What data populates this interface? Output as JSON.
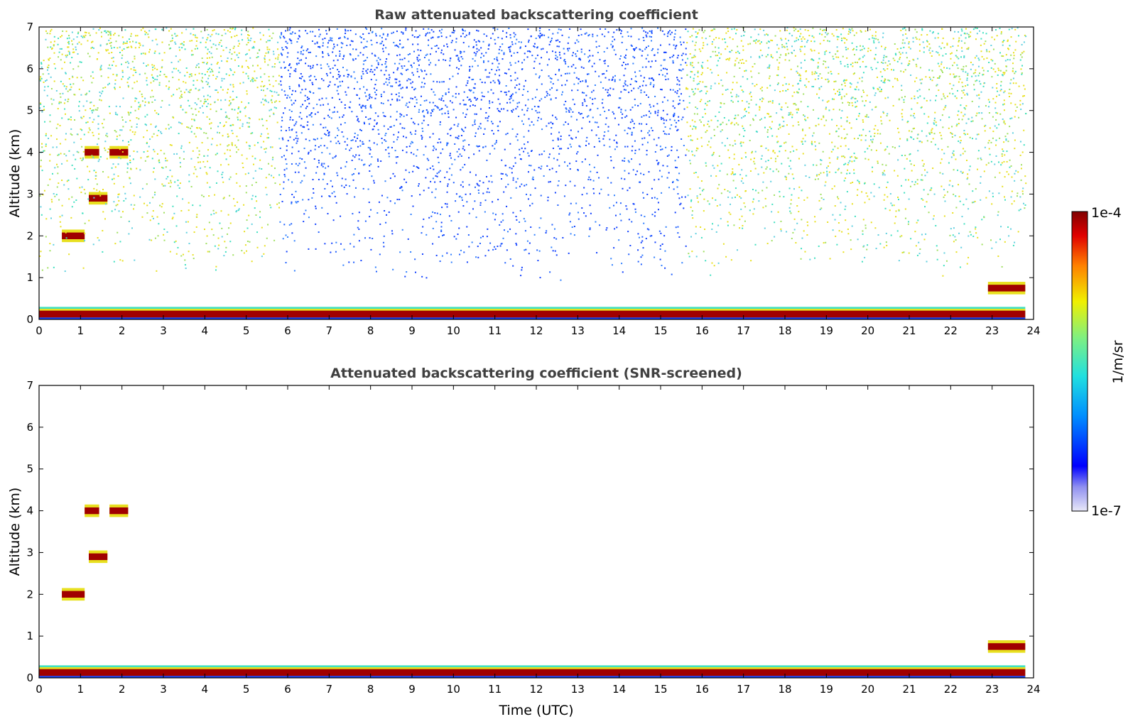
{
  "chart_data": [
    {
      "type": "heatmap",
      "title": "Raw attenuated backscattering coefficient",
      "xlabel": "",
      "ylabel": "Altitude (km)",
      "xlim": [
        0,
        24
      ],
      "ylim": [
        0,
        7
      ],
      "x_ticks": [
        "0",
        "1",
        "2",
        "3",
        "4",
        "5",
        "6",
        "7",
        "8",
        "9",
        "10",
        "11",
        "12",
        "13",
        "14",
        "15",
        "16",
        "17",
        "18",
        "19",
        "20",
        "21",
        "22",
        "23",
        "24"
      ],
      "y_ticks": [
        "0",
        "1",
        "2",
        "3",
        "4",
        "5",
        "6",
        "7"
      ],
      "features": [
        {
          "kind": "surface-layer",
          "t_start": 0,
          "t_end": 23.8,
          "alt_top": 0.3,
          "level": "high"
        },
        {
          "kind": "cloud-layer",
          "t_start": 0.55,
          "t_end": 1.1,
          "alt": 2.0,
          "level": "high"
        },
        {
          "kind": "cloud-layer",
          "t_start": 1.1,
          "t_end": 1.45,
          "alt": 4.0,
          "level": "high"
        },
        {
          "kind": "cloud-layer",
          "t_start": 1.7,
          "t_end": 2.15,
          "alt": 4.0,
          "level": "high"
        },
        {
          "kind": "cloud-layer",
          "t_start": 1.2,
          "t_end": 1.65,
          "alt": 2.9,
          "level": "high"
        },
        {
          "kind": "cloud-layer",
          "t_start": 22.9,
          "t_end": 23.8,
          "alt": 0.75,
          "level": "high"
        },
        {
          "kind": "noise-region",
          "t_start": 0,
          "t_end": 5.8,
          "alt_bottom": 1.0,
          "alt_top": 7,
          "level": "medium"
        },
        {
          "kind": "noise-region",
          "t_start": 5.8,
          "t_end": 15.6,
          "alt_bottom": 0.9,
          "alt_top": 7,
          "level": "low"
        },
        {
          "kind": "noise-region",
          "t_start": 15.6,
          "t_end": 23.8,
          "alt_bottom": 1.0,
          "alt_top": 7,
          "level": "medium"
        }
      ]
    },
    {
      "type": "heatmap",
      "title": "Attenuated backscattering coefficient (SNR-screened)",
      "xlabel": "Time (UTC)",
      "ylabel": "Altitude (km)",
      "xlim": [
        0,
        24
      ],
      "ylim": [
        0,
        7
      ],
      "x_ticks": [
        "0",
        "1",
        "2",
        "3",
        "4",
        "5",
        "6",
        "7",
        "8",
        "9",
        "10",
        "11",
        "12",
        "13",
        "14",
        "15",
        "16",
        "17",
        "18",
        "19",
        "20",
        "21",
        "22",
        "23",
        "24"
      ],
      "y_ticks": [
        "0",
        "1",
        "2",
        "3",
        "4",
        "5",
        "6",
        "7"
      ],
      "features": [
        {
          "kind": "surface-layer",
          "t_start": 0,
          "t_end": 23.8,
          "alt_top": 0.3,
          "level": "high"
        },
        {
          "kind": "cloud-layer",
          "t_start": 0.55,
          "t_end": 1.1,
          "alt": 2.0,
          "level": "high"
        },
        {
          "kind": "cloud-layer",
          "t_start": 1.1,
          "t_end": 1.45,
          "alt": 4.0,
          "level": "high"
        },
        {
          "kind": "cloud-layer",
          "t_start": 1.7,
          "t_end": 2.15,
          "alt": 4.0,
          "level": "high"
        },
        {
          "kind": "cloud-layer",
          "t_start": 1.2,
          "t_end": 1.65,
          "alt": 2.9,
          "level": "high"
        },
        {
          "kind": "cloud-layer",
          "t_start": 22.9,
          "t_end": 23.8,
          "alt": 0.75,
          "level": "high"
        }
      ]
    }
  ],
  "colorbar": {
    "label": "1/m/sr",
    "max_label": "1e-4",
    "min_label": "1e-7",
    "scale": "log",
    "colormap": "jet",
    "range": [
      1e-07,
      0.0001
    ]
  },
  "colors": {
    "background": "#ffffff",
    "axis": "#000000",
    "title": "#404040",
    "low": "#1040ff",
    "mid": "#40e0c0",
    "high_mid": "#e8e020",
    "high": "#a00000"
  }
}
